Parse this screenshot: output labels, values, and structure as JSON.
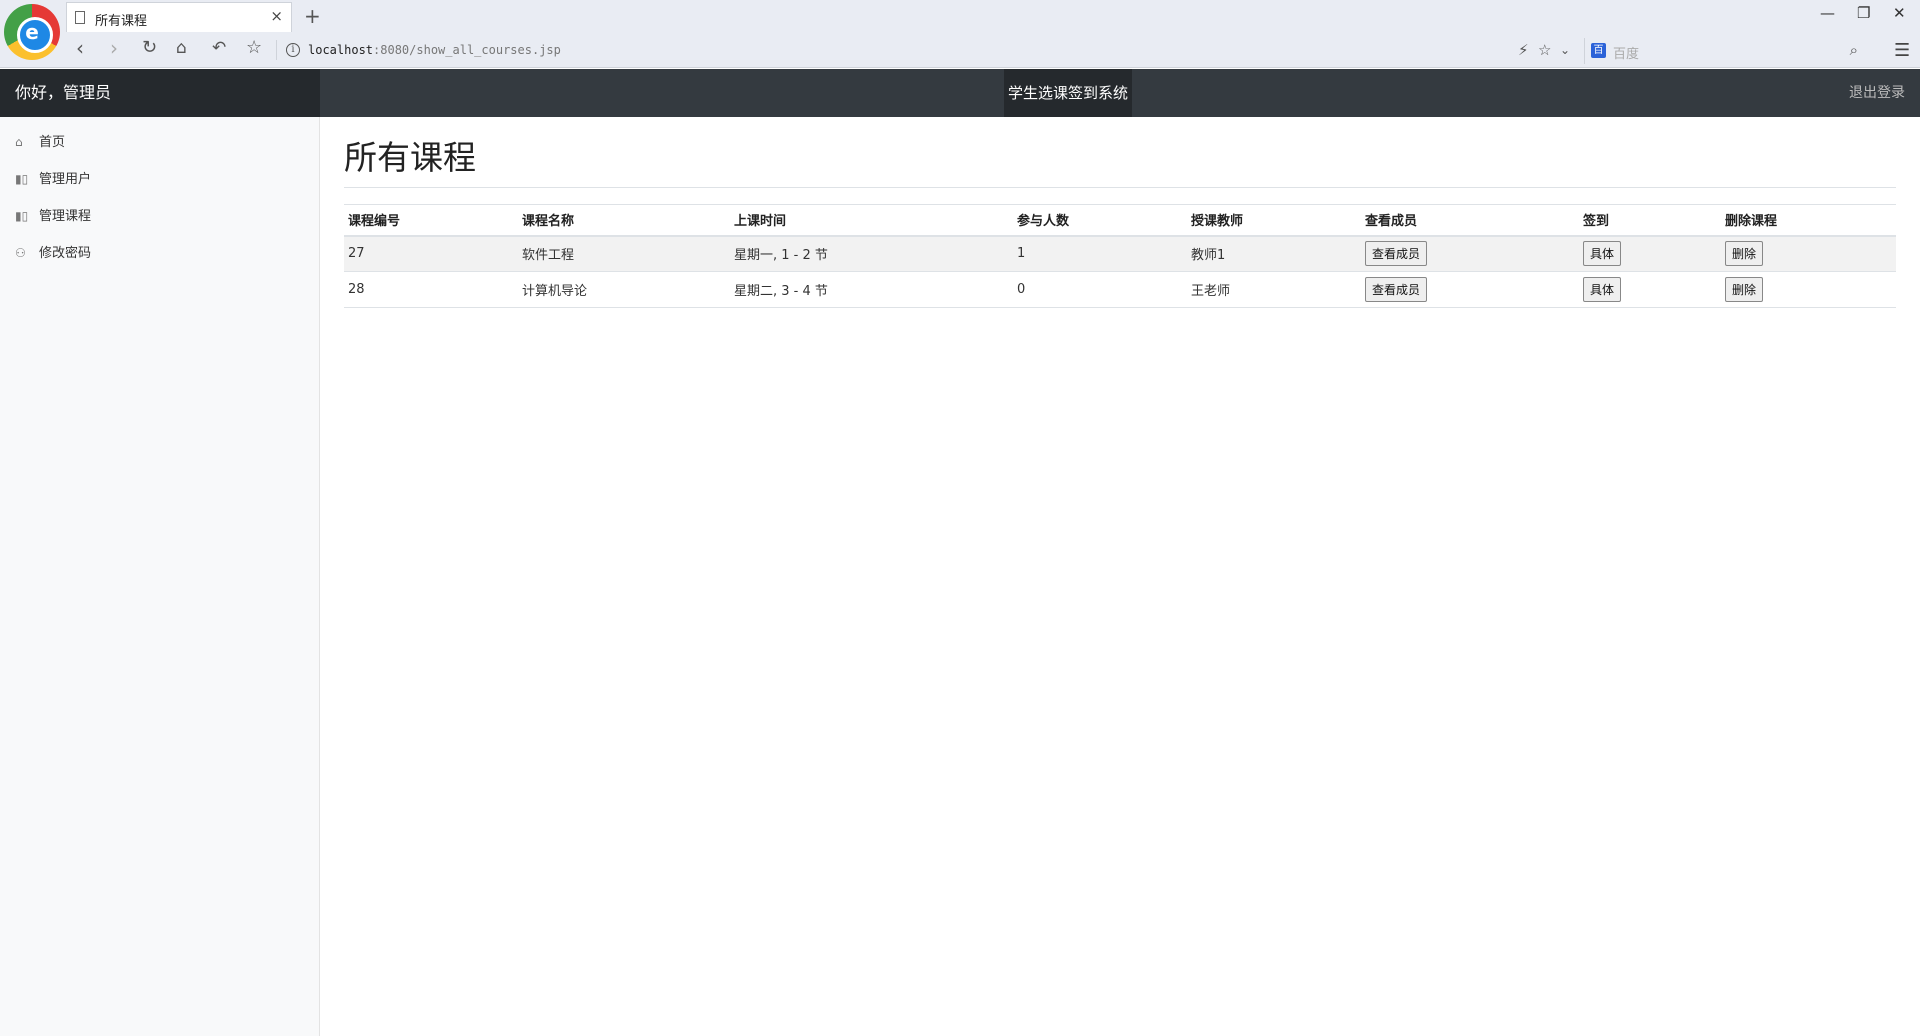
{
  "browser": {
    "tab_title": "所有课程",
    "tab_close": "×",
    "new_tab": "+",
    "url_host": "localhost",
    "url_rest": ":8080/show_all_courses.jsp",
    "search_placeholder": "百度",
    "window_controls": {
      "minimize": "—",
      "restore": "❐",
      "close": "✕"
    },
    "icons": [
      "browser-logo-icon",
      "back-icon",
      "forward-icon",
      "reload-icon",
      "home-icon",
      "undo-icon",
      "bookmark-star-icon",
      "info-icon",
      "lightning-icon",
      "star-icon",
      "chevron-down-icon",
      "baidu-icon",
      "search-icon",
      "menu-icon"
    ]
  },
  "navbar": {
    "greeting": "你好，管理员",
    "system_title": "学生选课签到系统",
    "logout": "退出登录",
    "colors": {
      "bar": "#343a40",
      "brand_bg": "#25292d"
    }
  },
  "sidebar": {
    "items": [
      {
        "label": "首页",
        "icon": "home-icon"
      },
      {
        "label": "管理用户",
        "icon": "bar-chart-icon"
      },
      {
        "label": "管理课程",
        "icon": "bar-chart-icon"
      },
      {
        "label": "修改密码",
        "icon": "users-icon"
      }
    ]
  },
  "main": {
    "title": "所有课程",
    "table": {
      "headers": [
        "课程编号",
        "课程名称",
        "上课时间",
        "参与人数",
        "授课教师",
        "查看成员",
        "签到",
        "删除课程"
      ],
      "rows": [
        {
          "id": "27",
          "name": "软件工程",
          "time": "星期一, 1 - 2 节",
          "count": "1",
          "teacher": "教师1",
          "view_btn": "查看成员",
          "sign_btn": "具体",
          "delete_btn": "删除"
        },
        {
          "id": "28",
          "name": "计算机导论",
          "time": "星期二, 3 - 4 节",
          "count": "0",
          "teacher": "王老师",
          "view_btn": "查看成员",
          "sign_btn": "具体",
          "delete_btn": "删除"
        }
      ]
    }
  }
}
